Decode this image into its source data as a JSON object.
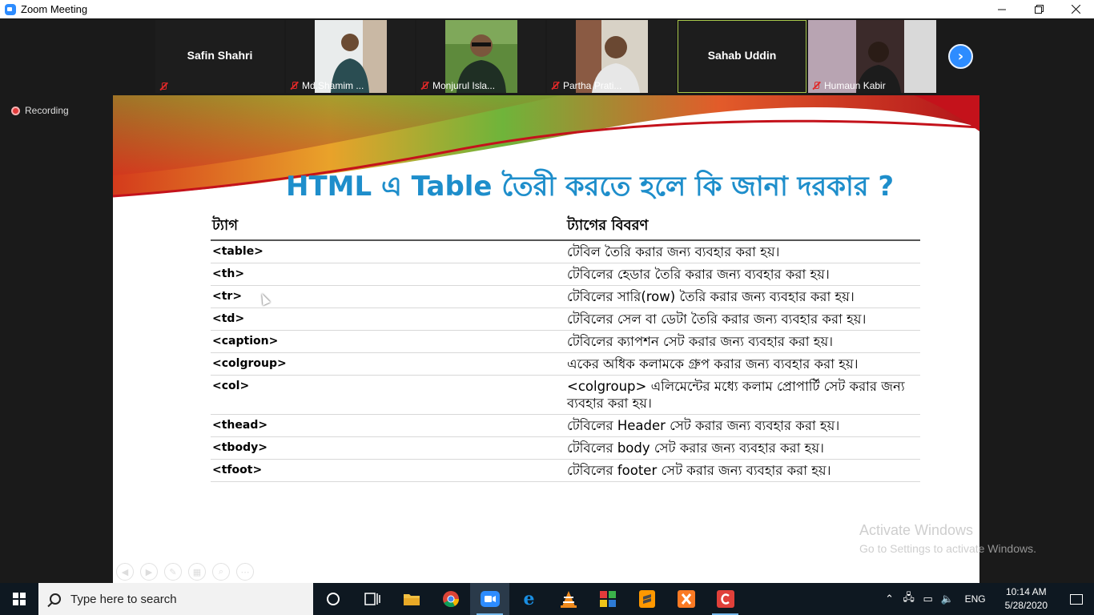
{
  "window": {
    "title": "Zoom Meeting",
    "controls": [
      "minimize",
      "restore",
      "close"
    ]
  },
  "participants": [
    {
      "name": "Safin Shahri",
      "label": "",
      "video": false,
      "muted": true,
      "active": false
    },
    {
      "name": "",
      "label": "Md.Shamim ...",
      "video": true,
      "muted": true,
      "active": false
    },
    {
      "name": "",
      "label": "Monjurul Isla...",
      "video": true,
      "muted": true,
      "active": false
    },
    {
      "name": "",
      "label": "Partha Prati...",
      "video": true,
      "muted": true,
      "active": false
    },
    {
      "name": "Sahab Uddin",
      "label": "",
      "video": false,
      "muted": false,
      "active": true
    },
    {
      "name": "",
      "label": "Humaun Kabir",
      "video": true,
      "muted": true,
      "active": false
    }
  ],
  "recording_label": "Recording",
  "slide": {
    "title": "HTML এ Table তৈরী করতে হলে কি জানা দরকার ?",
    "headers": [
      "ট্যাগ",
      "ট্যাগের বিবরণ"
    ],
    "rows": [
      {
        "tag": "<table>",
        "desc": "টেবিল তৈরি করার জন্য ব্যবহার করা হয়।"
      },
      {
        "tag": "<th>",
        "desc": "টেবিলের হেডার তৈরি করার জন্য ব্যবহার করা হয়।"
      },
      {
        "tag": "<tr>",
        "desc": "টেবিলের সারি(row) তৈরি করার জন্য ব্যবহার করা হয়।"
      },
      {
        "tag": "<td>",
        "desc": "টেবিলের সেল বা ডেটা তৈরি করার জন্য ব্যবহার করা হয়।"
      },
      {
        "tag": "<caption>",
        "desc": "টেবিলের ক্যাপশন সেট করার জন্য ব্যবহার করা হয়।"
      },
      {
        "tag": "<colgroup>",
        "desc": "একের অধিক কলামকে গ্রুপ করার জন্য ব্যবহার করা হয়।"
      },
      {
        "tag": "<col>",
        "desc": "<colgroup> এলিমেন্টের মধ্যে কলাম প্রোপার্টি সেট করার জন্য ব্যবহার করা হয়।"
      },
      {
        "tag": "<thead>",
        "desc": "টেবিলের Header সেট করার জন্য ব্যবহার করা হয়।"
      },
      {
        "tag": "<tbody>",
        "desc": "টেবিলের body সেট করার জন্য ব্যবহার করা হয়।"
      },
      {
        "tag": "<tfoot>",
        "desc": "টেবিলের footer সেট করার জন্য ব্যবহার করা হয়।"
      }
    ]
  },
  "activation": {
    "line1": "Activate Windows",
    "line2": "Go to Settings to activate Windows."
  },
  "taskbar": {
    "search_placeholder": "Type here to search",
    "apps": [
      "cortana",
      "task-view",
      "file-explorer",
      "chrome",
      "zoom",
      "edge",
      "vlc",
      "app-grid",
      "sublime-text",
      "xampp",
      "canva"
    ],
    "language": "ENG",
    "time": "10:14 AM",
    "date": "5/28/2020"
  },
  "colors": {
    "title_blue": "#1e8ecb",
    "zoom_blue": "#2d8cff",
    "taskbar_bg": "#0e1821"
  }
}
